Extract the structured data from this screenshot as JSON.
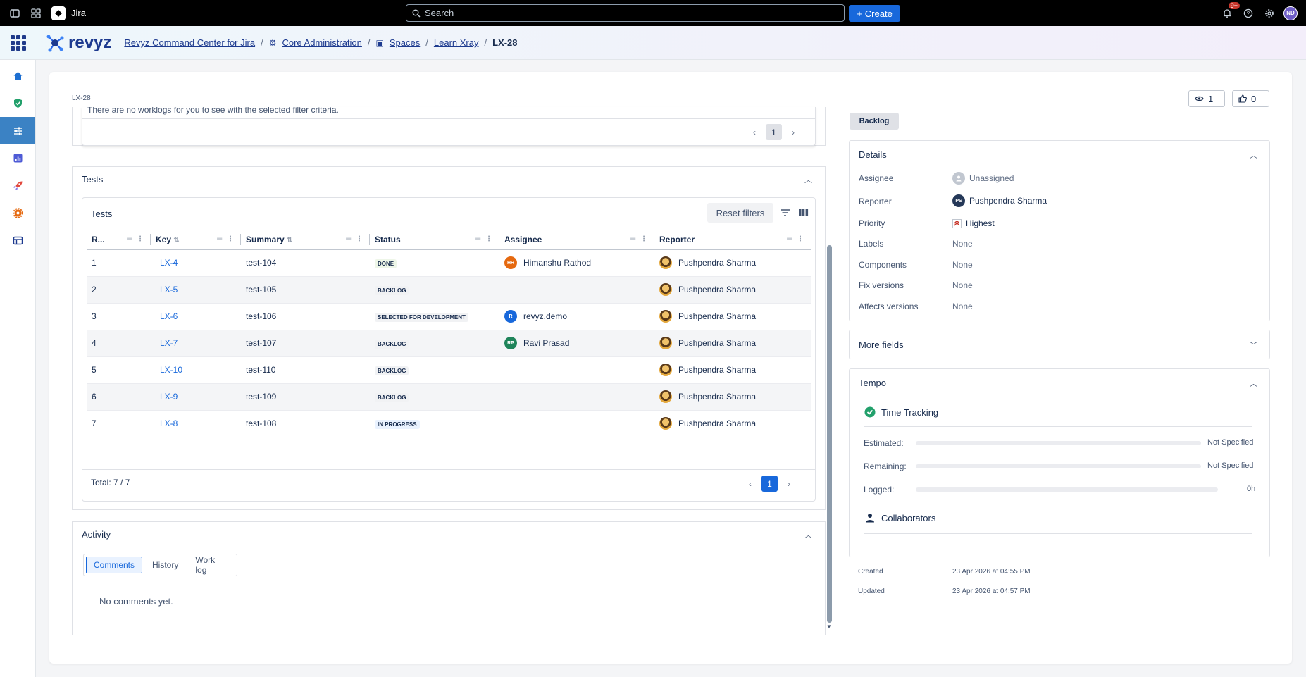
{
  "topbar": {
    "app_name": "Jira",
    "search_placeholder": "Search",
    "create_label": "Create",
    "notification_count": "9+",
    "user_initials": "ND"
  },
  "appbar": {
    "brand": "revyz",
    "breadcrumbs": [
      "Revyz Command Center for Jira",
      "Core Administration",
      "Spaces",
      "Learn Xray"
    ],
    "current": "LX-28"
  },
  "issue": {
    "key": "LX-28",
    "watchers": "1",
    "votes": "0",
    "status": "Backlog"
  },
  "worklog": {
    "empty_text": "There are no worklogs for you to see with the selected filter criteria.",
    "page": "1"
  },
  "tests_panel": {
    "title": "Tests",
    "inner_title": "Tests",
    "reset_label": "Reset filters",
    "columns": [
      "R...",
      "Key",
      "Summary",
      "Status",
      "Assignee",
      "Reporter"
    ],
    "rows": [
      {
        "rank": "1",
        "key": "LX-4",
        "summary": "test-104",
        "status": "DONE",
        "assignee": "Himanshu Rathod",
        "assignee_initials": "HR",
        "reporter": "Pushpendra Sharma"
      },
      {
        "rank": "2",
        "key": "LX-5",
        "summary": "test-105",
        "status": "BACKLOG",
        "assignee": "",
        "assignee_initials": "",
        "reporter": "Pushpendra Sharma"
      },
      {
        "rank": "3",
        "key": "LX-6",
        "summary": "test-106",
        "status": "SELECTED FOR DEVELOPMENT",
        "assignee": "revyz.demo",
        "assignee_initials": "R",
        "reporter": "Pushpendra Sharma"
      },
      {
        "rank": "4",
        "key": "LX-7",
        "summary": "test-107",
        "status": "BACKLOG",
        "assignee": "Ravi Prasad",
        "assignee_initials": "RP",
        "reporter": "Pushpendra Sharma"
      },
      {
        "rank": "5",
        "key": "LX-10",
        "summary": "test-110",
        "status": "BACKLOG",
        "assignee": "",
        "assignee_initials": "",
        "reporter": "Pushpendra Sharma"
      },
      {
        "rank": "6",
        "key": "LX-9",
        "summary": "test-109",
        "status": "BACKLOG",
        "assignee": "",
        "assignee_initials": "",
        "reporter": "Pushpendra Sharma"
      },
      {
        "rank": "7",
        "key": "LX-8",
        "summary": "test-108",
        "status": "IN PROGRESS",
        "assignee": "",
        "assignee_initials": "",
        "reporter": "Pushpendra Sharma"
      }
    ],
    "total": "Total: 7 / 7",
    "page": "1"
  },
  "activity": {
    "title": "Activity",
    "tabs": [
      "Comments",
      "History",
      "Work log"
    ],
    "empty_text": "No comments yet."
  },
  "details": {
    "title": "Details",
    "fields": [
      {
        "label": "Assignee",
        "value": "Unassigned"
      },
      {
        "label": "Reporter",
        "value": "Pushpendra Sharma",
        "initials": "PS"
      },
      {
        "label": "Priority",
        "value": "Highest"
      },
      {
        "label": "Labels",
        "value": "None"
      },
      {
        "label": "Components",
        "value": "None"
      },
      {
        "label": "Fix versions",
        "value": "None"
      },
      {
        "label": "Affects versions",
        "value": "None"
      }
    ]
  },
  "more_fields": {
    "title": "More fields"
  },
  "tempo": {
    "title": "Tempo",
    "time_tracking": "Time Tracking",
    "estimated_label": "Estimated:",
    "estimated_value": "Not Specified",
    "remaining_label": "Remaining:",
    "remaining_value": "Not Specified",
    "logged_label": "Logged:",
    "logged_value": "0h",
    "collaborators": "Collaborators"
  },
  "meta": {
    "created_label": "Created",
    "created_value": "23 Apr 2026 at 04:55 PM",
    "updated_label": "Updated",
    "updated_value": "23 Apr 2026 at 04:57 PM"
  },
  "colors": {
    "accent": "#1868db",
    "topbar": "#000000",
    "brand": "#1d3a8f",
    "sidebar_active": "#3b82c4",
    "done_check": "#22a06b"
  }
}
